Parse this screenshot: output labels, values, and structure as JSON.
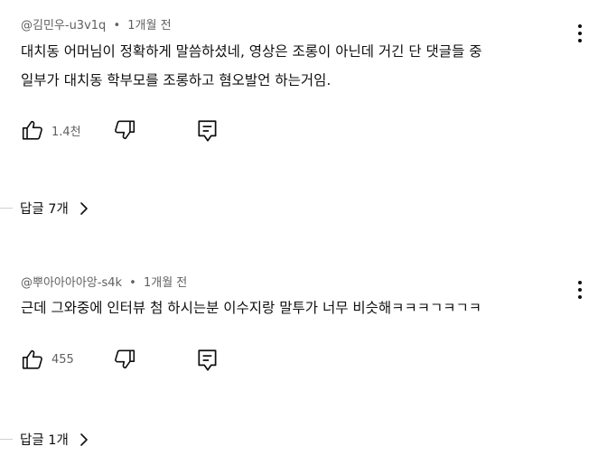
{
  "comments": [
    {
      "author": "@김민우-u3v1q",
      "separator": "•",
      "time": "1개월 전",
      "lines": [
        "대치동 어머님이 정확하게 말씀하셨네, 영상은 조롱이 아닌데 거긴 단 댓글들 중",
        "일부가 대치동 학부모를 조롱하고 혐오발언 하는거임."
      ],
      "likes": "1.4천",
      "replies_label": "답글 7개"
    },
    {
      "author": "@뿌아아아아앙-s4k",
      "separator": "•",
      "time": "1개월 전",
      "lines": [
        "근데 그와중에 인터뷰 첨 하시는분 이수지랑 말투가 너무 비슷해ㅋㅋㅋㄱㅋㄱㅋ"
      ],
      "likes": "455",
      "replies_label": "답글 1개"
    }
  ],
  "icons": {
    "like": "thumbs-up-icon",
    "dislike": "thumbs-down-icon",
    "reply": "comment-icon",
    "menu": "more-vertical-icon",
    "expand": "chevron-right-icon"
  },
  "colors": {
    "text": "#0f0f0f",
    "secondary": "#606060",
    "divider": "#cfcfcf",
    "background": "#ffffff"
  }
}
